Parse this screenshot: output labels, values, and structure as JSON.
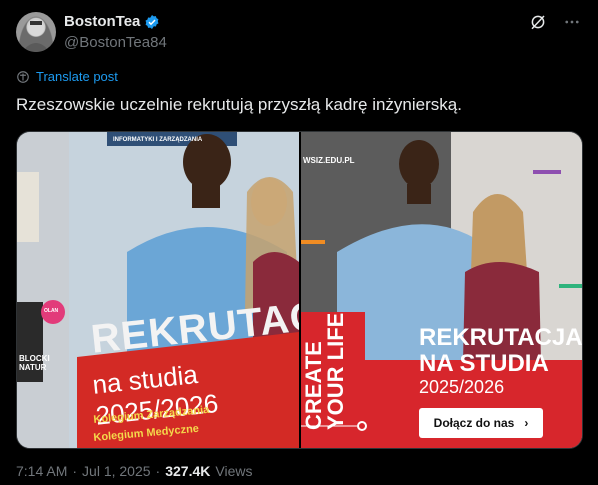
{
  "author": {
    "display_name": "BostonTea",
    "handle": "@BostonTea84",
    "verified_color": "#1d9bf0"
  },
  "actions": {
    "grok_icon": "grok-icon",
    "more_icon": "more-icon"
  },
  "translate_label": "Translate post",
  "post_text": "Rzeszowskie uczelnie rekrutują przyszłą kadrę inżynierską.",
  "media": {
    "left_photo": {
      "top_banner": "INFORMATYKI I ZARZĄDZANIA",
      "heading": "REKRUTACJA",
      "subheading": "na studia 2025/2026",
      "line1": "Kolegium Zarządzania",
      "line2": "Kolegium Medyczne",
      "side_badge": "OLAN",
      "side_label": "BLOCKI\nNATUR"
    },
    "right_photo": {
      "url": "WSIZ.EDU.PL",
      "vertical_text": "CREATE YOUR LIFE",
      "heading1": "REKRUTACJA",
      "heading2": "NA STUDIA",
      "years": "2025/2026",
      "cta_label": "Dołącz do nas",
      "accent_red": "#d7262c"
    }
  },
  "meta": {
    "time": "7:14 AM",
    "sep1": "·",
    "date": "Jul 1, 2025",
    "sep2": "·",
    "views_count": "327.4K",
    "views_label": "Views"
  }
}
